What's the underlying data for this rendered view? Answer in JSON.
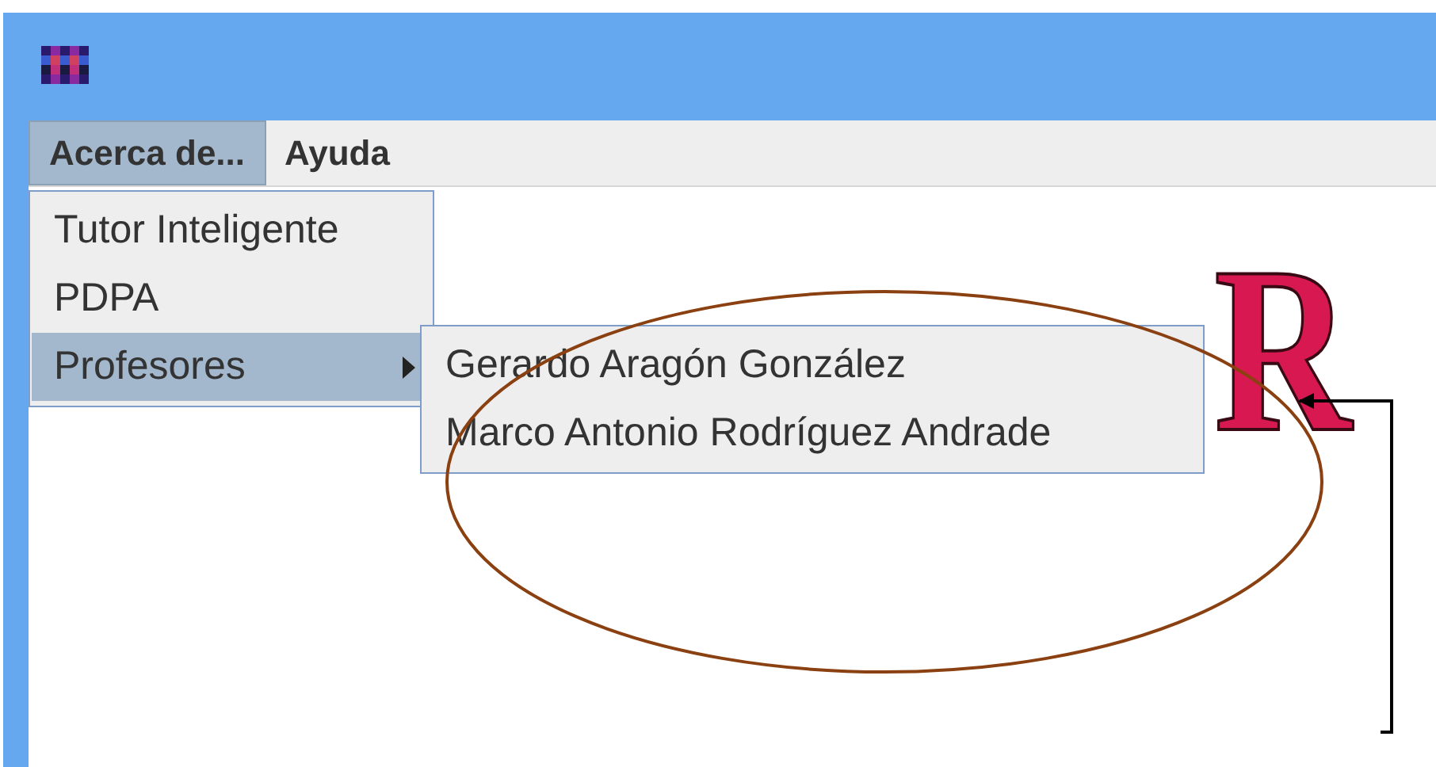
{
  "menu_bar": [
    {
      "label": "Acerca de...",
      "selected": true
    },
    {
      "label": "Ayuda",
      "selected": false
    }
  ],
  "menu": {
    "items": [
      {
        "label": "Tutor Inteligente",
        "selected": false,
        "submenu": false
      },
      {
        "label": "PDPA",
        "selected": false,
        "submenu": false
      },
      {
        "label": "Profesores",
        "selected": true,
        "submenu": true
      }
    ]
  },
  "submenu": {
    "items": [
      {
        "label": "Gerardo Aragón González",
        "selected": false
      },
      {
        "label": "Marco Antonio Rodríguez Andrade",
        "selected": false
      }
    ]
  },
  "logo": {
    "text": "R"
  },
  "annotations": {
    "ellipse": true,
    "arrow": true
  }
}
